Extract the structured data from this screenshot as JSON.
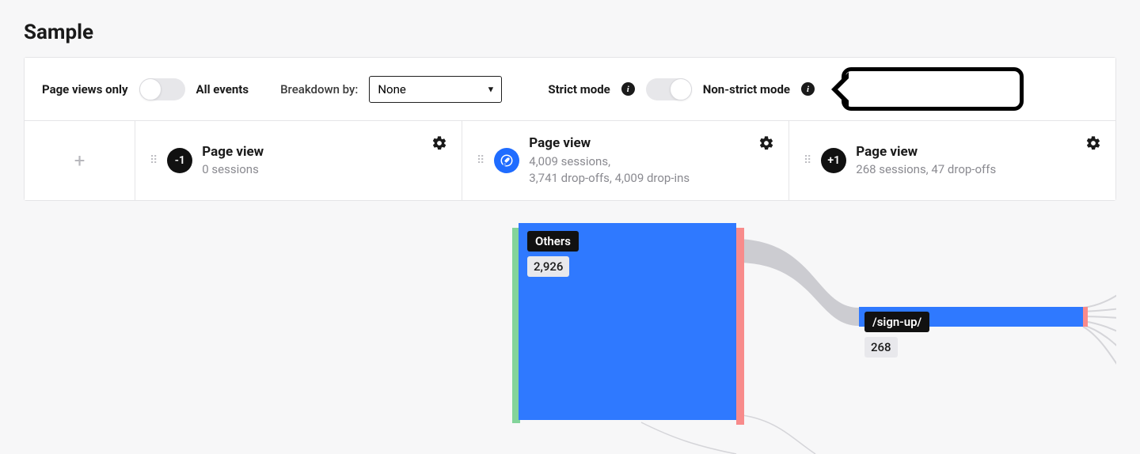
{
  "page_title": "Sample",
  "toolbar": {
    "page_views_only_label": "Page views only",
    "all_events_label": "All events",
    "breakdown_label": "Breakdown by:",
    "breakdown_value": "None",
    "strict_mode_label": "Strict mode",
    "non_strict_mode_label": "Non-strict mode"
  },
  "steps": {
    "s0": {
      "badge": "-1",
      "title": "Page view",
      "line1": "0 sessions",
      "line2": ""
    },
    "s1": {
      "title": "Page view",
      "line1": "4,009 sessions,",
      "line2": "3,741 drop-offs, 4,009 drop-ins"
    },
    "s2": {
      "badge": "+1",
      "title": "Page view",
      "line1": "268 sessions, 47 drop-offs",
      "line2": ""
    }
  },
  "flow": {
    "node_main_label": "Others",
    "node_main_value": "2,926",
    "node_side_label": "/sign-up/",
    "node_side_value": "268"
  }
}
